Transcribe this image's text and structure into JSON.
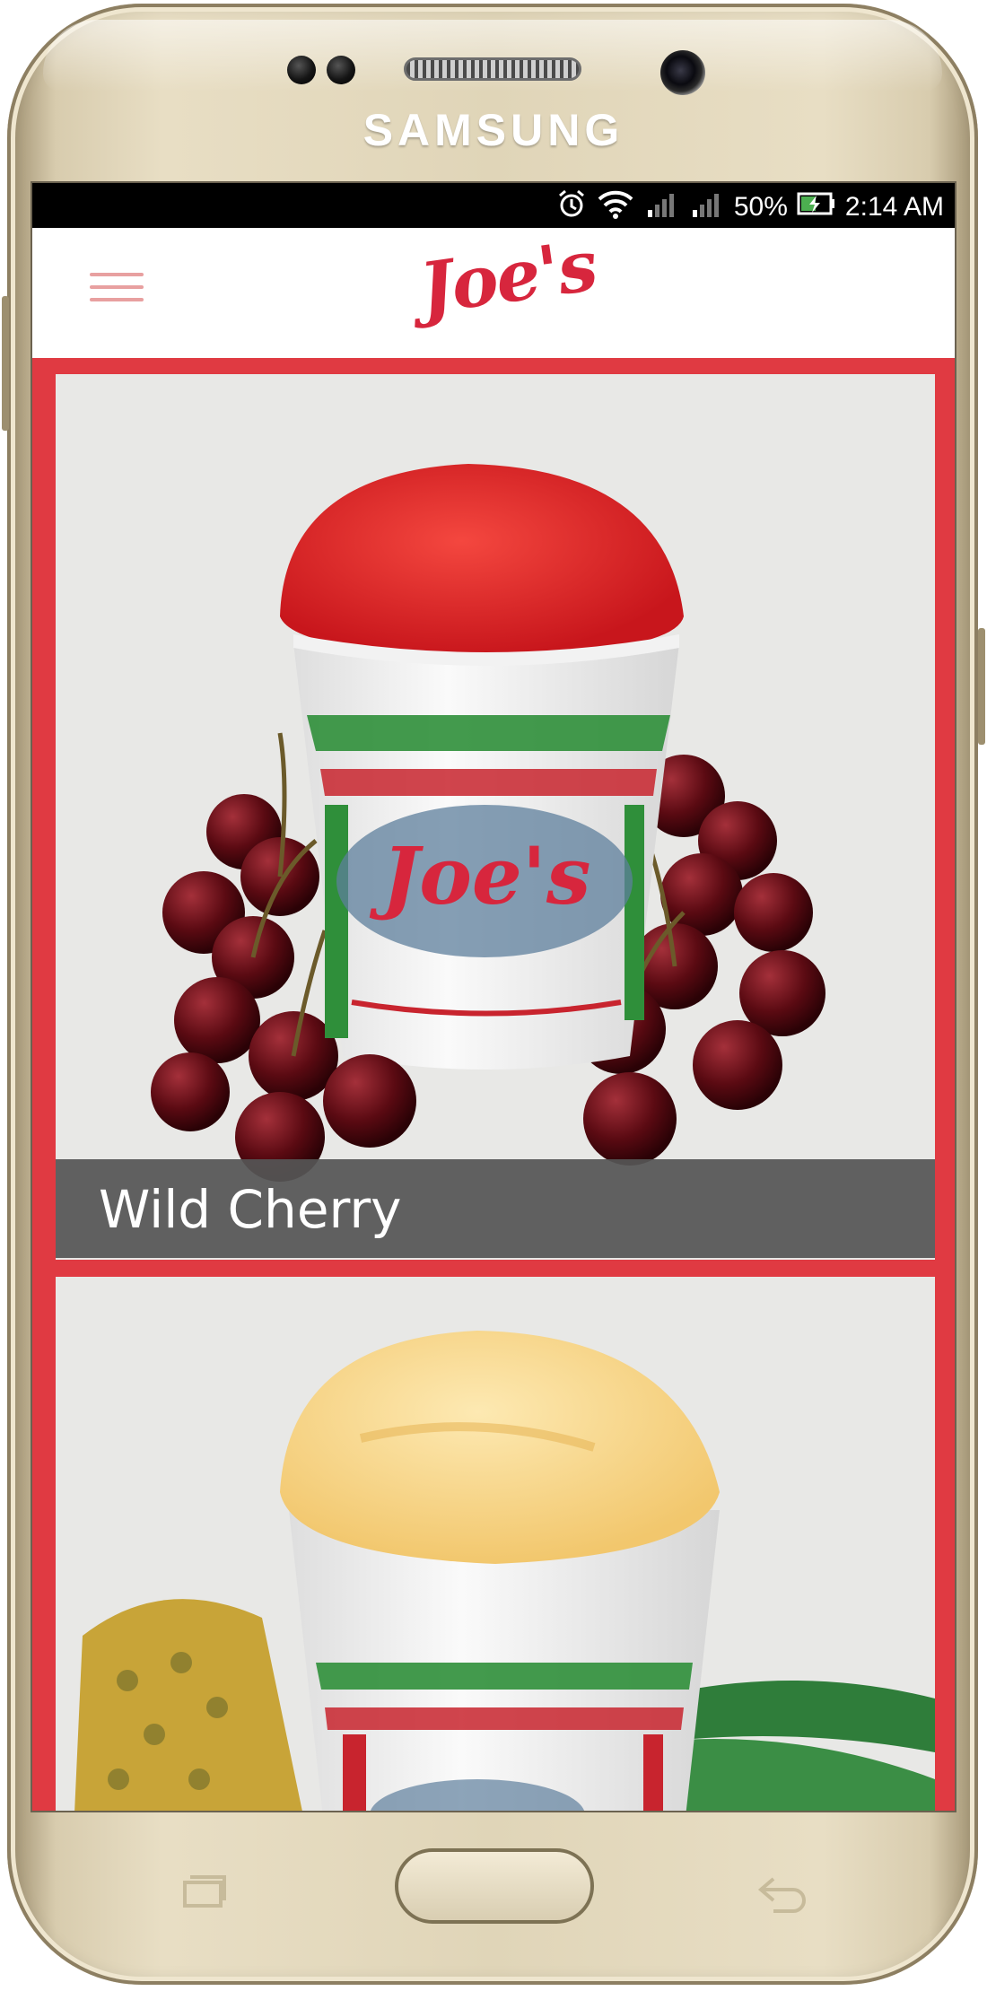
{
  "device": {
    "brand": "SAMSUNG"
  },
  "status_bar": {
    "battery": "50%",
    "time": "2:14 AM"
  },
  "app": {
    "logo_text": "Joe's",
    "accent_color": "#e03a42"
  },
  "products": [
    {
      "name": "Wild Cherry",
      "flavor_color": "#e8282f"
    },
    {
      "name": "",
      "flavor_color": "#f7d98a"
    }
  ]
}
